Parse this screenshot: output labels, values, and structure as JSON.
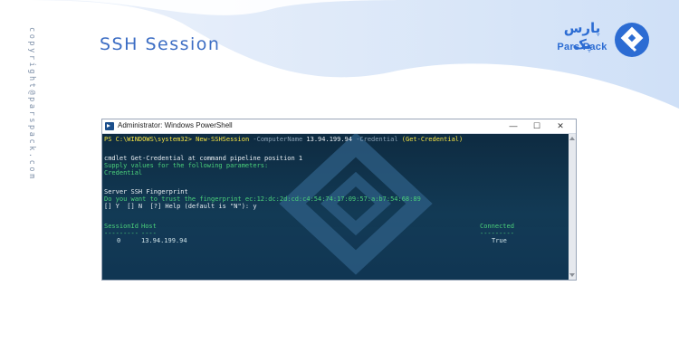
{
  "page": {
    "title": "SSH Session",
    "copyright": "copyright@parspack.com"
  },
  "logo": {
    "name_fa": "پارس پک",
    "name_en": "Pars Pack",
    "mark": "diamond-logo-icon"
  },
  "window": {
    "title": "Administrator: Windows PowerShell",
    "minimize": "—",
    "maximize": "☐",
    "close": "✕"
  },
  "console": {
    "prompt": "PS C:\\WINDOWS\\system32>",
    "command": "New-SSHSession",
    "param1": "-ComputerName",
    "value1": "13.94.199.94",
    "param2": "-Credential",
    "value2": "(Get-Credential)",
    "cmdlet_line": "cmdlet Get-Credential at command pipeline position 1",
    "supply_line": "Supply values for the following parameters:",
    "credential_line": "Credential",
    "fingerprint_title": "Server SSH Fingerprint",
    "trust_prompt": "Do you want to trust the fingerprint ec:12:dc:2d:cd:c4:54:74:17:09:57:a:b7:54:68:89",
    "choices": "[] Y  [] N  [?] Help (default is \"N\"): y",
    "table": {
      "header_session": "SessionId",
      "header_host": "Host",
      "header_connected": "Connected",
      "underline_session": "---------",
      "underline_host": "----",
      "underline_connected": "---------",
      "row_session": "0",
      "row_host": "13.94.199.94",
      "row_connected": "True"
    }
  },
  "colors": {
    "accent": "#3d6ec4",
    "console_bg": "#0f2f45",
    "prompt_text": "#f5e342",
    "output_text": "#4bd07a"
  }
}
